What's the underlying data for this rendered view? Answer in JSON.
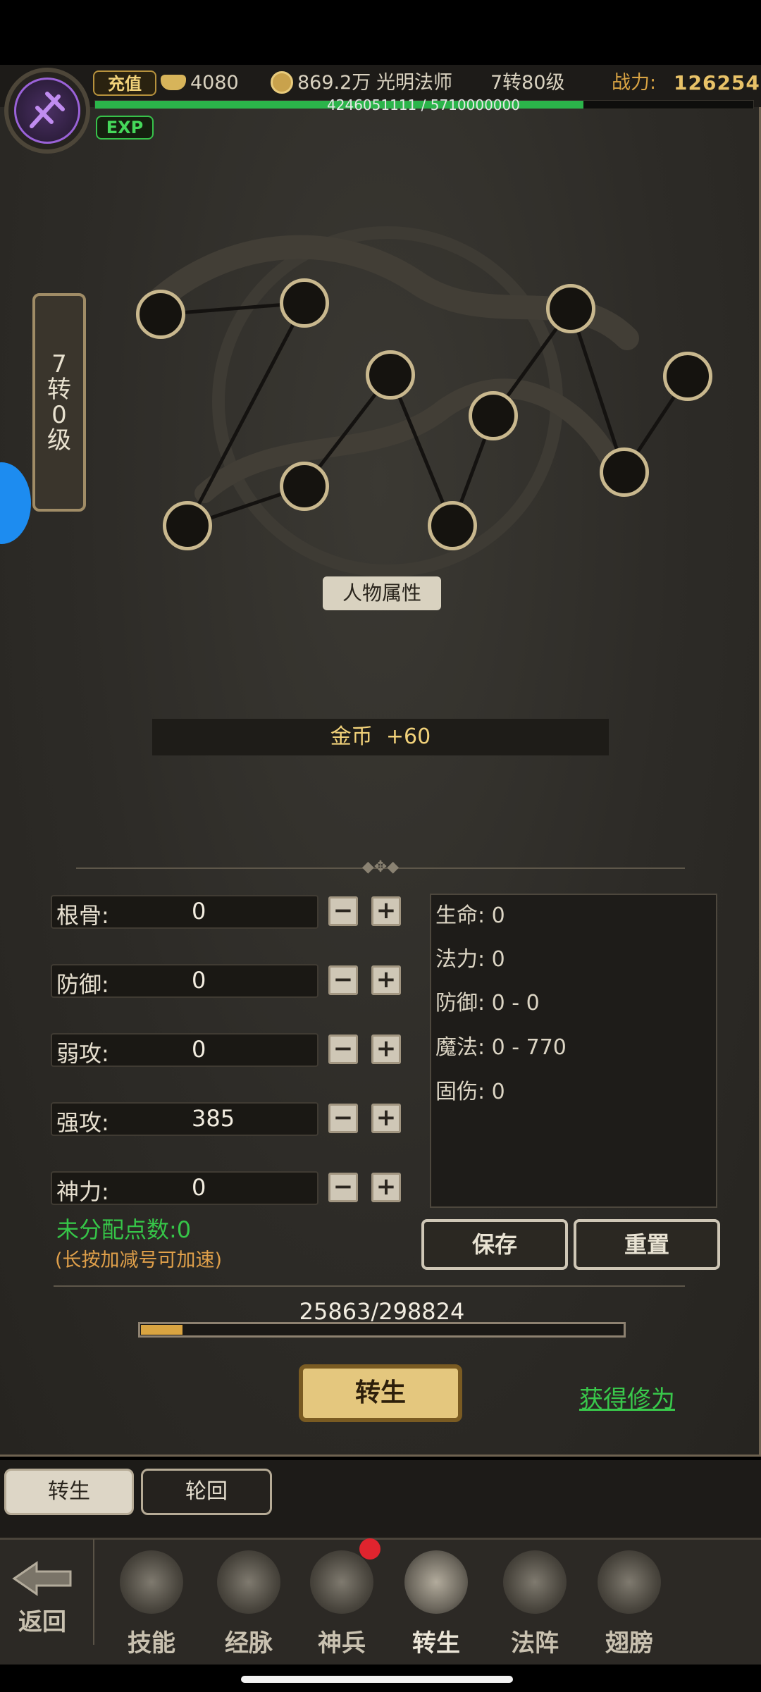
{
  "header": {
    "recharge_label": "充值",
    "ingots": "4080",
    "coins": "869.2万",
    "class_name": "光明法师",
    "level": "7转80级",
    "power_label": "战力:",
    "power_value": "126254",
    "exp_text": "4246051111 / 5710000000",
    "exp_progress": 0.744,
    "exp_badge": "EXP"
  },
  "level_banner": {
    "line1": "7",
    "line2": "转",
    "line3": "0",
    "line4": "级"
  },
  "attr_title": "人物属性",
  "bonus": {
    "label": "金币",
    "value": "+60"
  },
  "stats": [
    {
      "label": "根骨:",
      "value": "0"
    },
    {
      "label": "防御:",
      "value": "0"
    },
    {
      "label": "弱攻:",
      "value": "0"
    },
    {
      "label": "强攻:",
      "value": "385"
    },
    {
      "label": "神力:",
      "value": "0"
    }
  ],
  "results": [
    "生命: 0",
    "法力: 0",
    "防御: 0 - 0",
    "魔法: 0 - 770",
    "固伤: 0"
  ],
  "unassigned": "未分配点数:0",
  "hint": "(长按加减号可加速)",
  "buttons": {
    "save": "保存",
    "reset": "重置",
    "rebirth": "转生",
    "obtain": "获得修为"
  },
  "progress": {
    "text": "25863/298824",
    "fraction": 0.0866
  },
  "subtabs": [
    "转生",
    "轮回"
  ],
  "nav": {
    "back": "返回",
    "items": [
      "技能",
      "经脉",
      "神兵",
      "转生",
      "法阵",
      "翅膀"
    ]
  },
  "colors": {
    "accent_gold": "#e8c268",
    "exp_green": "#2bb44a",
    "link_green": "#39c84b"
  }
}
